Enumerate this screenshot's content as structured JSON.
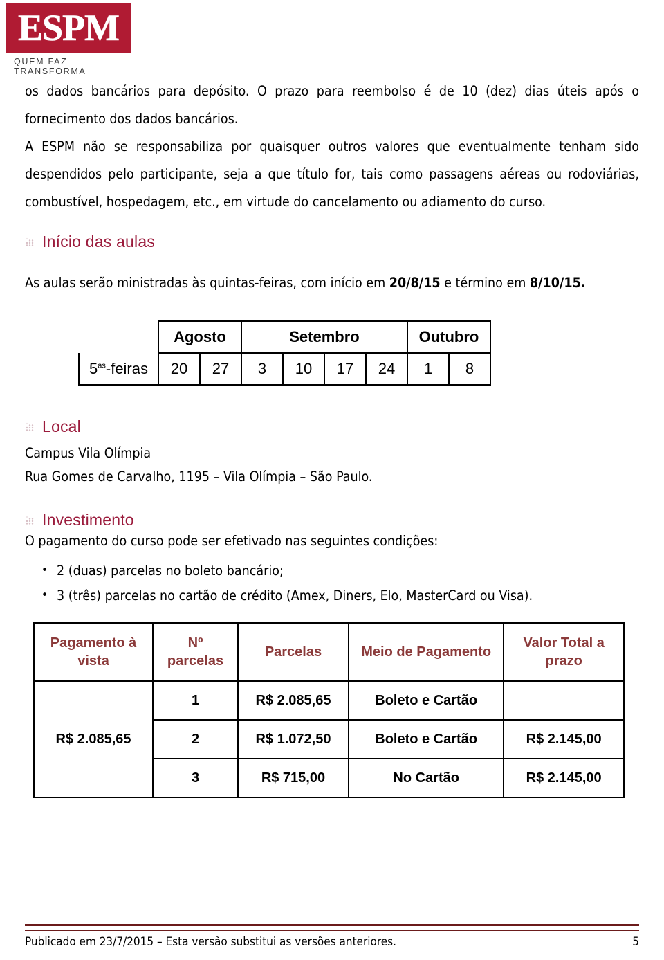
{
  "logo": {
    "word": "ESPM",
    "tagline": "QUEM FAZ TRANSFORMA",
    "box_color": "#B01B33"
  },
  "colors": {
    "heading": "#9B1B3C",
    "table_header": "#8B3A3A",
    "footer_rule": "#6B1B1B"
  },
  "body": {
    "paragraph1": "os dados bancários para depósito. O prazo para reembolso é de 10 (dez) dias úteis após o fornecimento dos dados bancários.",
    "paragraph2": "A ESPM não se responsabiliza por quaisquer outros valores que eventualmente tenham sido despendidos pelo participante, seja a que título for, tais como passagens aéreas ou rodoviárias, combustível, hospedagem, etc., em virtude do cancelamento ou adiamento do curso."
  },
  "section_aulas": {
    "heading": "Início das aulas",
    "intro_prefix": "As aulas serão ministradas às quintas-feiras, com início em ",
    "start_date": "20/8/15",
    "intro_middle": " e término em ",
    "end_date": "8/10/15",
    "intro_suffix": "."
  },
  "calendar": {
    "row_label_main": "5",
    "row_label_sup": "as",
    "row_label_rest": "-feiras",
    "months": [
      {
        "name": "Agosto",
        "span": 2
      },
      {
        "name": "Setembro",
        "span": 4
      },
      {
        "name": "Outubro",
        "span": 2
      }
    ],
    "days": [
      "20",
      "27",
      "3",
      "10",
      "17",
      "24",
      "1",
      "8"
    ]
  },
  "section_local": {
    "heading": "Local",
    "campus": "Campus Vila Olímpia",
    "address": "Rua Gomes de Carvalho, 1195 – Vila Olímpia – São Paulo."
  },
  "section_investimento": {
    "heading": "Investimento",
    "intro": "O pagamento do curso pode ser efetivado nas seguintes condições:",
    "conditions": [
      "2 (duas) parcelas no boleto bancário;",
      "3 (três) parcelas no cartão de crédito (Amex, Diners, Elo, MasterCard ou Visa)."
    ]
  },
  "payment_table": {
    "headers": [
      "Pagamento à vista",
      "Nº parcelas",
      "Parcelas",
      "Meio de Pagamento",
      "Valor Total a prazo"
    ],
    "a_vista_value": "R$ 2.085,65",
    "rows": [
      {
        "n": "1",
        "parcela": "R$ 2.085,65",
        "meio": "Boleto e Cartão",
        "total": ""
      },
      {
        "n": "2",
        "parcela": "R$ 1.072,50",
        "meio": "Boleto e Cartão",
        "total": "R$ 2.145,00"
      },
      {
        "n": "3",
        "parcela": "R$ 715,00",
        "meio": "No Cartão",
        "total": "R$ 2.145,00"
      }
    ]
  },
  "footer": {
    "note": "Publicado em 23/7/2015 – Esta versão substitui as versões anteriores.",
    "page_number": "5"
  }
}
